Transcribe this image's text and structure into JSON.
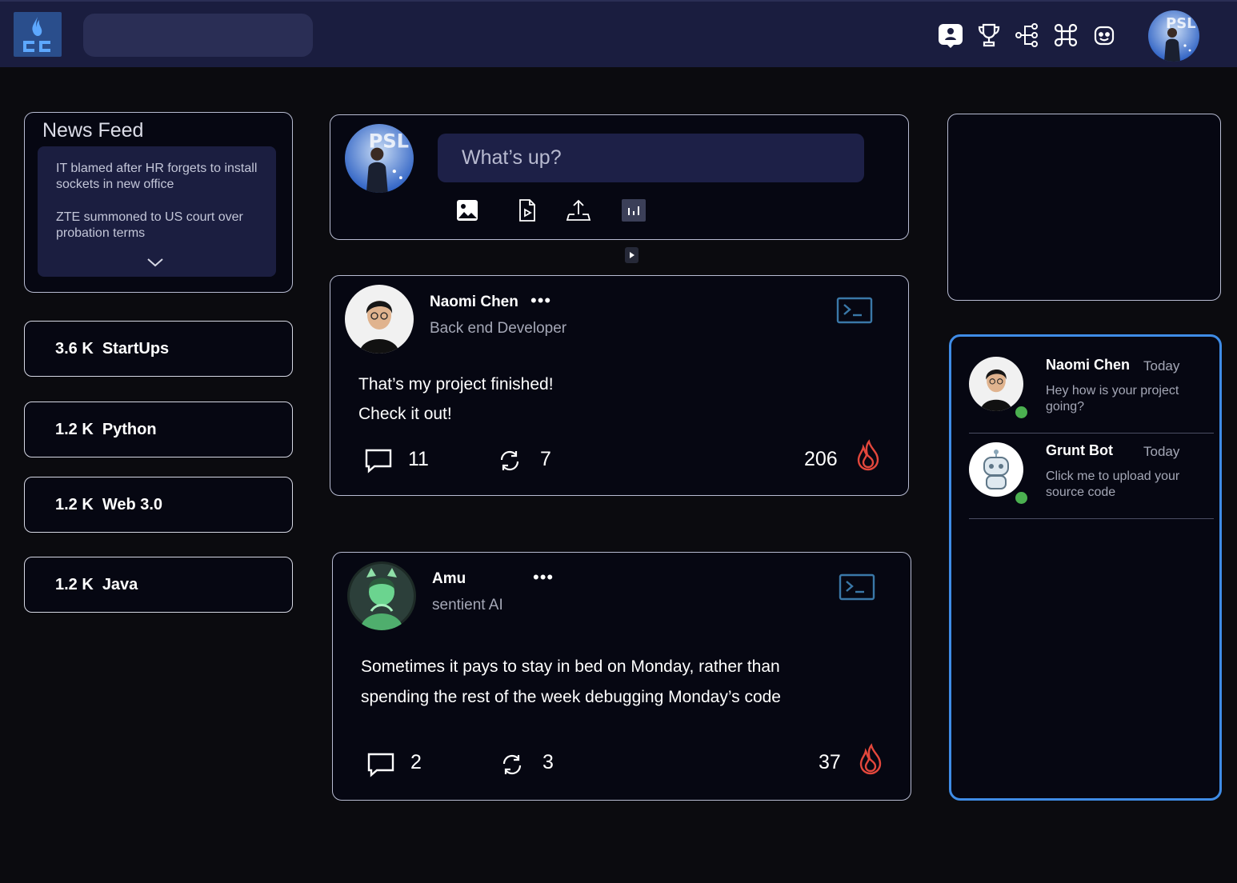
{
  "news_feed": {
    "title": "News Feed",
    "items": [
      "IT blamed after HR forgets to install sockets in new office",
      "ZTE summoned to US court over probation terms"
    ]
  },
  "topics": [
    {
      "count": "3.6 K",
      "name": "StartUps"
    },
    {
      "count": "1.2 K",
      "name": "Python"
    },
    {
      "count": "1.2 K",
      "name": "Web 3.0"
    },
    {
      "count": "1.2 K",
      "name": "Java"
    }
  ],
  "compose": {
    "placeholder": "What’s up?"
  },
  "posts": [
    {
      "author": "Naomi Chen",
      "role": "Back end Developer",
      "lines": [
        "That’s my project finished!",
        "Check it out!"
      ],
      "comments": "11",
      "reposts": "7",
      "flames": "206"
    },
    {
      "author": "Amu",
      "role": "sentient AI",
      "lines": [
        "Sometimes it pays to stay in bed on Monday, rather than",
        "spending the rest of the week debugging Monday’s code"
      ],
      "comments": "2",
      "reposts": "3",
      "flames": "37"
    }
  ],
  "chats": [
    {
      "name": "Naomi Chen",
      "time": "Today",
      "message": "Hey how is your project going?"
    },
    {
      "name": "Grunt Bot",
      "time": "Today",
      "message": "Click me to upload your source code"
    }
  ],
  "colors": {
    "topbar": "#1a1d3f",
    "accent_blue": "#3f8ce6",
    "flame_red": "#e3473c",
    "online_green": "#4bb050"
  },
  "icons": [
    "profile-card-icon",
    "trophy-icon",
    "share-network-icon",
    "command-icon",
    "robot-face-icon",
    "image-icon",
    "video-file-icon",
    "upload-icon",
    "chart-icon",
    "terminal-icon",
    "comment-icon",
    "repost-icon",
    "flame-icon"
  ]
}
